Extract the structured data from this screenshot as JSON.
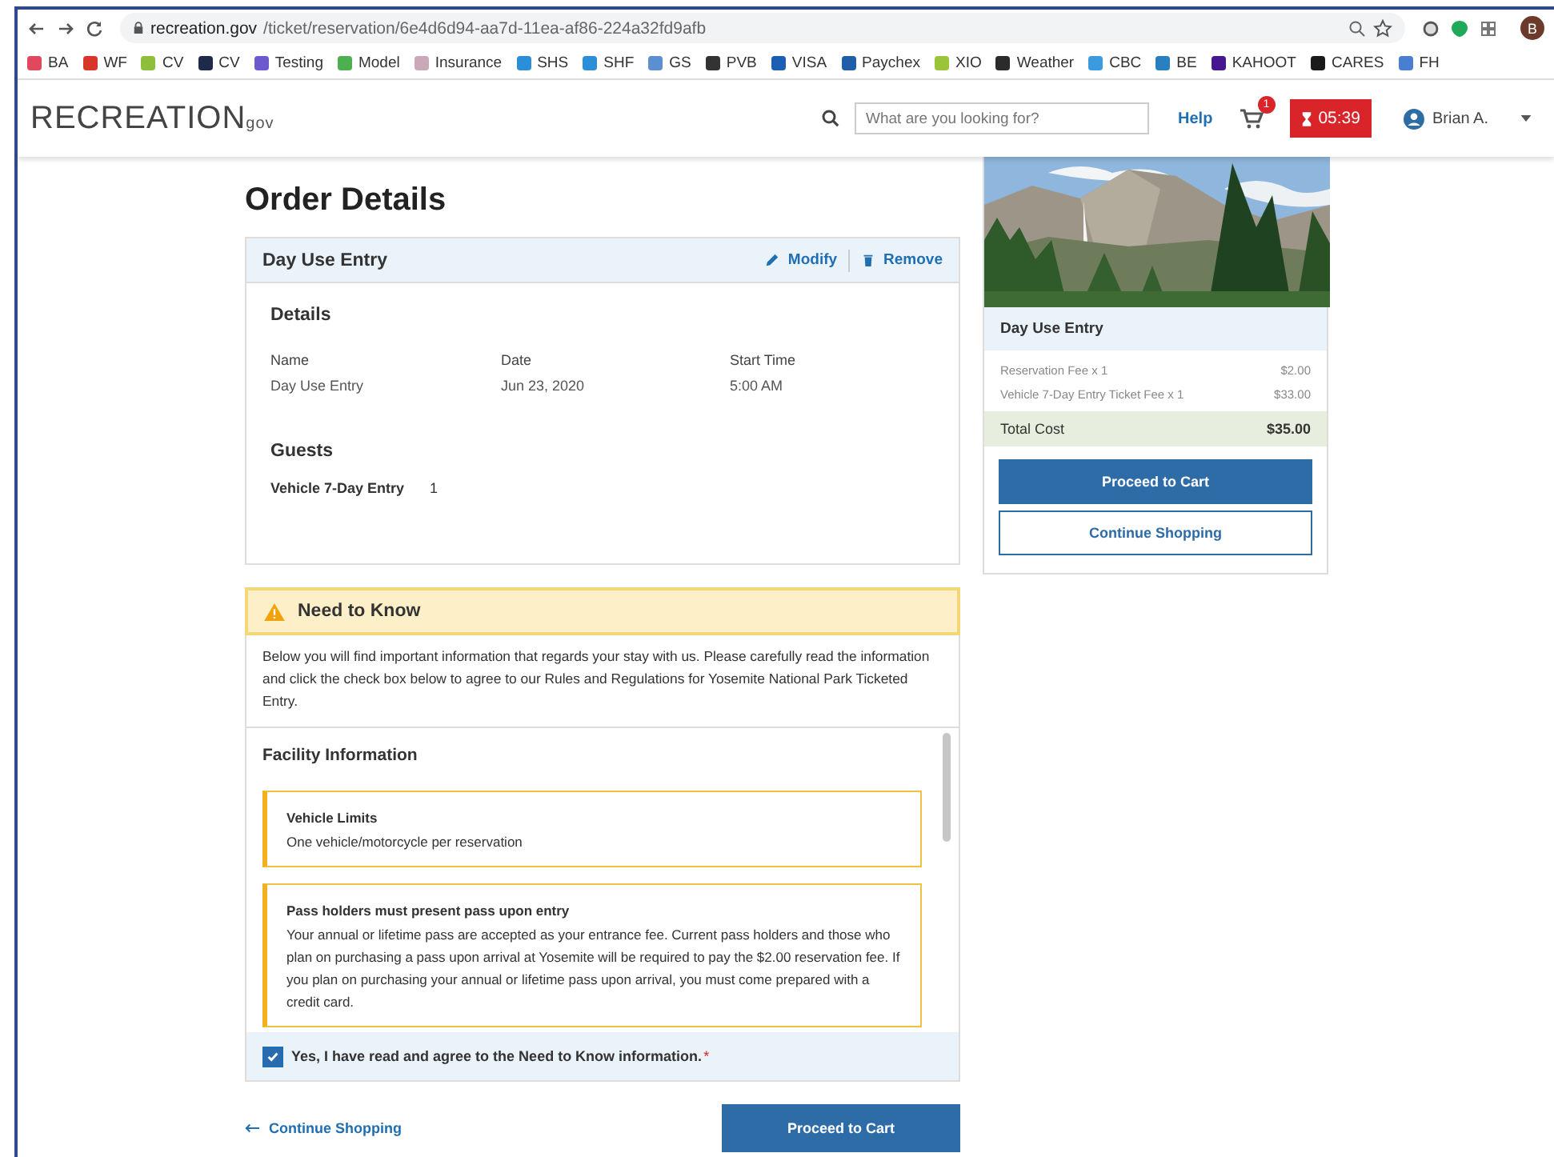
{
  "browser": {
    "url_host": "recreation.gov",
    "url_path": "/ticket/reservation/6e4d6d94-aa7d-11ea-af86-224a32fd9afb",
    "profile_initial": "B",
    "bookmarks": [
      {
        "label": "BA",
        "color": "#e0485e"
      },
      {
        "label": "WF",
        "color": "#d9362b"
      },
      {
        "label": "CV",
        "color": "#8fbf3a"
      },
      {
        "label": "CV",
        "color": "#1e2a4a"
      },
      {
        "label": "Testing",
        "color": "#6a5acd"
      },
      {
        "label": "Model",
        "color": "#4caf50"
      },
      {
        "label": "Insurance",
        "color": "#c9a8b8"
      },
      {
        "label": "SHS",
        "color": "#2a8fd6"
      },
      {
        "label": "SHF",
        "color": "#2a8fd6"
      },
      {
        "label": "GS",
        "color": "#5b8fd0"
      },
      {
        "label": "PVB",
        "color": "#333333"
      },
      {
        "label": "VISA",
        "color": "#1a5fb4"
      },
      {
        "label": "Paychex",
        "color": "#1f5fa8"
      },
      {
        "label": "XIO",
        "color": "#9ac43a"
      },
      {
        "label": "Weather",
        "color": "#2b2b2b"
      },
      {
        "label": "CBC",
        "color": "#3a9be0"
      },
      {
        "label": "BE",
        "color": "#2a7fc0"
      },
      {
        "label": "KAHOOT",
        "color": "#46178f"
      },
      {
        "label": "CARES",
        "color": "#1a1a1a"
      },
      {
        "label": "FH",
        "color": "#4a7fd0"
      }
    ]
  },
  "header": {
    "logo": "RECREATION",
    "logo_suffix": "gov",
    "search": {
      "placeholder": "What are you looking for?"
    },
    "help": "Help",
    "cart_count": "1",
    "timer": "05:39",
    "user": "Brian A."
  },
  "order": {
    "title": "Order Details",
    "item": {
      "name": "Day Use Entry",
      "actions": [
        "Modify",
        "Remove"
      ]
    },
    "details": {
      "heading": "Details",
      "fields": [
        {
          "label": "Name",
          "value": "Day Use Entry"
        },
        {
          "label": "Date",
          "value": "Jun 23, 2020"
        },
        {
          "label": "Start Time",
          "value": "5:00 AM"
        }
      ]
    },
    "guests": {
      "heading": "Guests",
      "rows": [
        {
          "label": "Vehicle 7-Day Entry",
          "value": "1"
        }
      ]
    }
  },
  "need_to_know": {
    "title": "Need to Know",
    "intro": "Below you will find important information that regards your stay with us. Please carefully read the information and click the check box below to agree to our Rules and Regulations for Yosemite National Park Ticketed Entry.",
    "facility": {
      "heading": "Facility Information",
      "notices": [
        {
          "title": "Vehicle Limits",
          "body": "One vehicle/motorcycle per reservation"
        },
        {
          "title": "Pass holders must present pass upon entry",
          "body": "Your annual or lifetime pass are accepted as your entrance fee. Current pass holders and those who plan on purchasing a pass upon arrival at Yosemite will be required to pay the $2.00 reservation fee. If you plan on purchasing your annual or lifetime pass upon arrival, you must come prepared with a credit card."
        }
      ]
    },
    "agree": {
      "label": "Yes, I have read and agree to the Need to Know information.",
      "required_mark": "*",
      "checked": true
    }
  },
  "footer": {
    "back_link": "Continue Shopping",
    "proceed": "Proceed to Cart"
  },
  "summary": {
    "heading": "Day Use Entry",
    "fees": [
      {
        "label": "Reservation Fee x 1",
        "amount": "$2.00"
      },
      {
        "label": "Vehicle 7-Day Entry Ticket Fee x 1",
        "amount": "$33.00"
      }
    ],
    "total": {
      "label": "Total Cost",
      "amount": "$35.00"
    },
    "primary": "Proceed to Cart",
    "secondary": "Continue Shopping"
  }
}
